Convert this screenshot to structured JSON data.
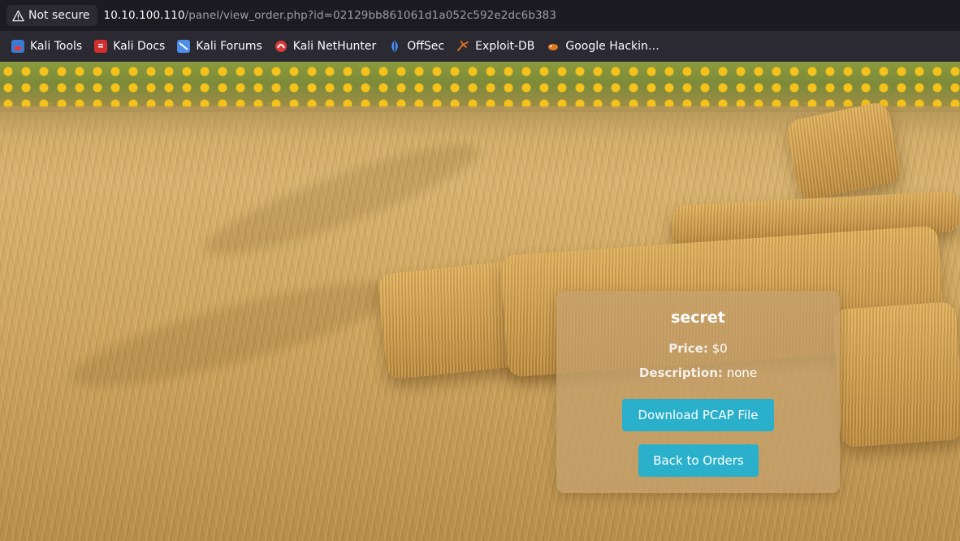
{
  "browser": {
    "security_label": "Not secure",
    "url_host": "10.10.100.110",
    "url_path": "/panel/view_order.php?id=02129bb861061d1a052c592e2dc6b383",
    "icons": {
      "security": "warning-triangle-icon"
    }
  },
  "bookmarks": [
    {
      "label": "Kali Tools",
      "icon": "kali-tools-icon",
      "color": "#3a7bd5"
    },
    {
      "label": "Kali Docs",
      "icon": "kali-docs-icon",
      "color": "#d42f2f"
    },
    {
      "label": "Kali Forums",
      "icon": "kali-forums-icon",
      "color": "#4c8ee8"
    },
    {
      "label": "Kali NetHunter",
      "icon": "kali-nethunter-icon",
      "color": "#d93a3a"
    },
    {
      "label": "OffSec",
      "icon": "offsec-icon",
      "color": "#4a8cf0"
    },
    {
      "label": "Exploit-DB",
      "icon": "exploit-db-icon",
      "color": "#e0781f"
    },
    {
      "label": "Google Hackin…",
      "icon": "google-hacking-icon",
      "color": "#e0781f"
    }
  ],
  "order": {
    "title": "secret",
    "price_label": "Price:",
    "price_value": "$0",
    "description_label": "Description:",
    "description_value": "none",
    "download_button": "Download PCAP File",
    "back_button": "Back to Orders"
  },
  "colors": {
    "button": "#2ab0cb",
    "card": "rgba(196,160,108,0.78)"
  }
}
